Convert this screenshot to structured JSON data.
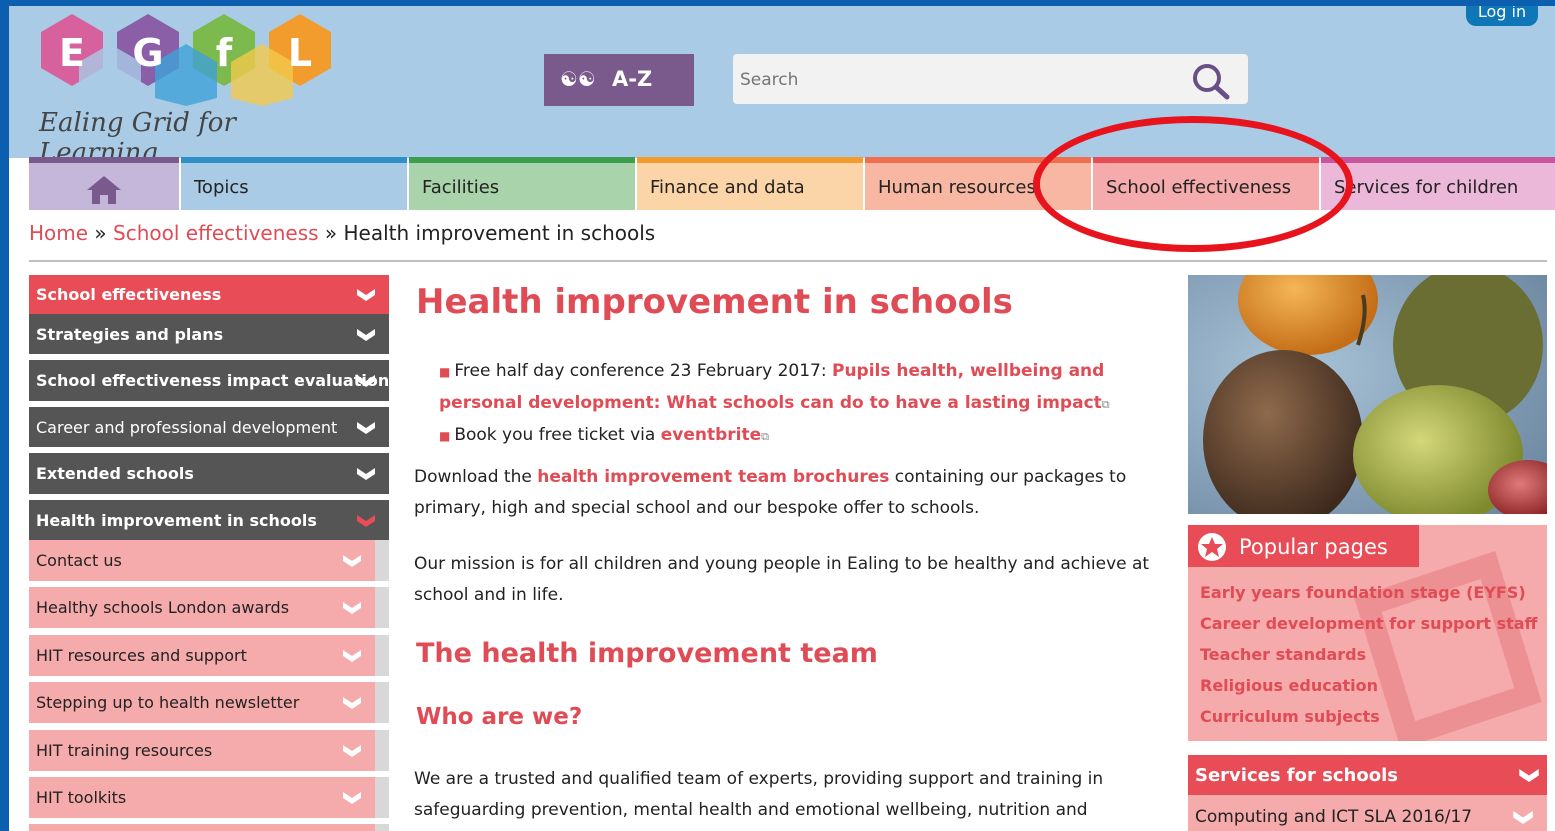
{
  "header": {
    "login_label": "Log in",
    "logo_letters": [
      "E",
      "G",
      "f",
      "L"
    ],
    "logo_subtitle": "Ealing Grid for Learning",
    "az_label": "A-Z",
    "search_placeholder": "Search"
  },
  "nav": {
    "items": [
      {
        "label": "",
        "icon": "home-icon",
        "color": "#c5b7d9",
        "accent": "#7a5a8c"
      },
      {
        "label": "Topics",
        "color": "#a9cbe6",
        "accent": "#2f8fc8"
      },
      {
        "label": "Facilities",
        "color": "#a9d3ab",
        "accent": "#3d9e50"
      },
      {
        "label": "Finance and data",
        "color": "#fbd4a8",
        "accent": "#f39c2e"
      },
      {
        "label": "Human resources",
        "color": "#f8b7a2",
        "accent": "#ee6e4d"
      },
      {
        "label": "School effectiveness",
        "color": "#f5aaab",
        "accent": "#e84d57"
      },
      {
        "label": "Services for children",
        "color": "#ecb8d9",
        "accent": "#c9559c"
      }
    ]
  },
  "breadcrumb": {
    "home": "Home",
    "sep": "»",
    "section": "School effectiveness",
    "current": "Health improvement in schools"
  },
  "left_menu": {
    "items": [
      {
        "label": "School effectiveness",
        "style": "red"
      },
      {
        "label": "Strategies and plans",
        "style": "dark"
      },
      {
        "label": "School effectiveness impact evaluation",
        "style": "dark"
      },
      {
        "label": "Career and professional development",
        "style": "dark"
      },
      {
        "label": "Extended schools",
        "style": "dark"
      },
      {
        "label": "Health improvement in schools",
        "style": "dark-active"
      },
      {
        "label": "Contact us",
        "style": "pink"
      },
      {
        "label": "Healthy schools London awards",
        "style": "pink"
      },
      {
        "label": "HIT resources and support",
        "style": "pink"
      },
      {
        "label": "Stepping up to health newsletter",
        "style": "pink"
      },
      {
        "label": "HIT training resources",
        "style": "pink"
      },
      {
        "label": "HIT toolkits",
        "style": "pink"
      }
    ]
  },
  "main": {
    "title": "Health improvement in schools",
    "bullet1_prefix": "Free half day conference 23 February 2017: ",
    "bullet1_link_line1": "Pupils health, wellbeing and",
    "bullet1_link_line2": "personal development: What schools can do to have a lasting impact",
    "bullet2_prefix": "Book you free ticket via ",
    "bullet2_link": "eventbrite",
    "download_prefix": "Download the ",
    "download_link": "health improvement team brochures",
    "download_suffix1": " containing our packages to",
    "download_suffix2": "primary, high and special school and our bespoke offer to schools.",
    "mission_line1": "Our mission is for all children and young people in Ealing to be healthy and achieve at",
    "mission_line2": "school and in life.",
    "team_heading": "The health improvement team",
    "who_heading": "Who are we?",
    "who_line1": "We are a trusted and qualified team of experts, providing support and training in",
    "who_line2": "safeguarding prevention, mental health and emotional wellbeing, nutrition and"
  },
  "sidebar": {
    "popular_title": "Popular pages",
    "popular_links": [
      "Early years foundation stage (EYFS)",
      "Career development for support staff",
      "Teacher standards",
      "Religious education",
      "Curriculum subjects"
    ],
    "services_title": "Services for schools",
    "services_item": "Computing and ICT SLA 2016/17"
  }
}
